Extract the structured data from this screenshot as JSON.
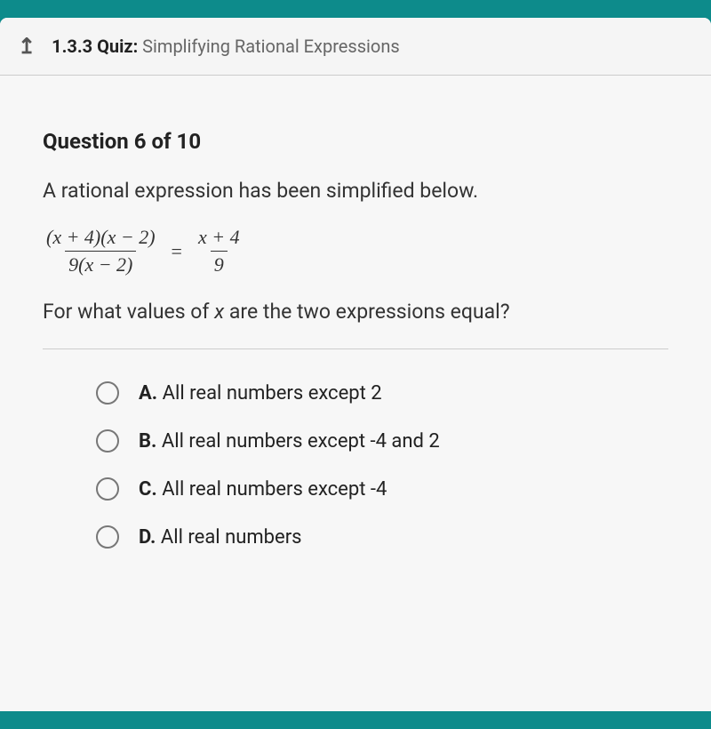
{
  "header": {
    "section": "1.3.3",
    "type": "Quiz:",
    "title": "Simplifying Rational Expressions"
  },
  "question": {
    "progress": "Question 6 of 10",
    "prompt": "A rational expression has been simplified below.",
    "equation": {
      "left_num": "(x + 4)(x − 2)",
      "left_den": "9(x − 2)",
      "right_num": "x + 4",
      "right_den": "9"
    },
    "followup_pre": "For what values of ",
    "followup_var": "x",
    "followup_post": " are the two expressions equal?"
  },
  "options": [
    {
      "letter": "A.",
      "text": "All real numbers except 2"
    },
    {
      "letter": "B.",
      "text": "All real numbers except -4 and 2"
    },
    {
      "letter": "C.",
      "text": "All real numbers except -4"
    },
    {
      "letter": "D.",
      "text": "All real numbers"
    }
  ]
}
